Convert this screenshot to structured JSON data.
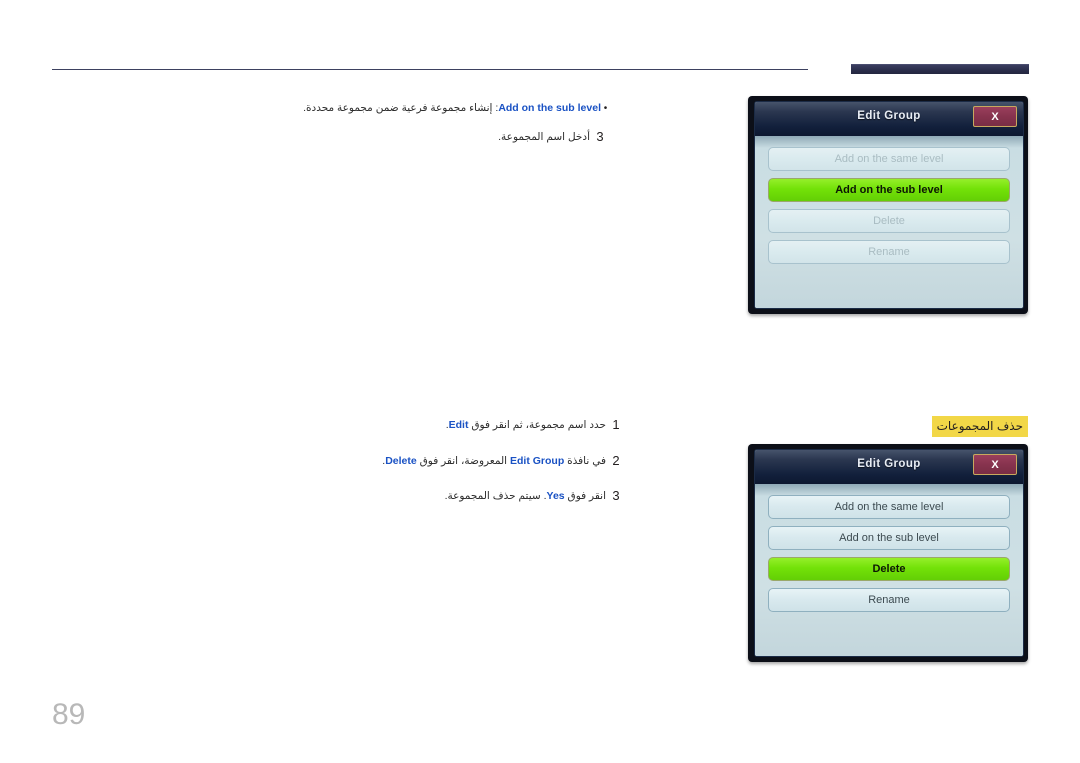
{
  "page": {
    "number": "89"
  },
  "top_section": {
    "bullet": {
      "marker": "•",
      "term": "Add on the sub level",
      "description": ": إنشاء مجموعة فرعية ضمن مجموعة محددة."
    },
    "step": {
      "number": "3",
      "text": "أدخل اسم المجموعة."
    }
  },
  "section_heading": {
    "label": "حذف المجموعات"
  },
  "steps": [
    {
      "number": "1",
      "prefix": "حدد اسم مجموعة، ثم انقر فوق ",
      "keyword": "Edit",
      "suffix": "."
    },
    {
      "number": "2",
      "prefix": "في نافذة ",
      "keyword": "Edit Group",
      "middle": " المعروضة، انقر فوق ",
      "keyword2": "Delete",
      "suffix": "."
    },
    {
      "number": "3",
      "prefix": "انقر فوق ",
      "keyword": "Yes",
      "suffix": ". سيتم حذف المجموعة."
    }
  ],
  "dialogs": [
    {
      "title": "Edit Group",
      "close_label": "X",
      "buttons": [
        {
          "label": "Add on the same level",
          "state": "dim"
        },
        {
          "label": "Add on the sub level",
          "state": "sel"
        },
        {
          "label": "Delete",
          "state": "dim"
        },
        {
          "label": "Rename",
          "state": "dim"
        }
      ]
    },
    {
      "title": "Edit Group",
      "close_label": "X",
      "buttons": [
        {
          "label": "Add on the same level",
          "state": "normal"
        },
        {
          "label": "Add on the sub level",
          "state": "normal"
        },
        {
          "label": "Delete",
          "state": "sel"
        },
        {
          "label": "Rename",
          "state": "normal"
        }
      ]
    }
  ],
  "colors": {
    "accent_blue": "#1a52c4",
    "highlight_yellow": "#f2d747",
    "selection_green": "#73e208",
    "header_bar": "#2b2e4c",
    "close_button": "#87334e"
  }
}
